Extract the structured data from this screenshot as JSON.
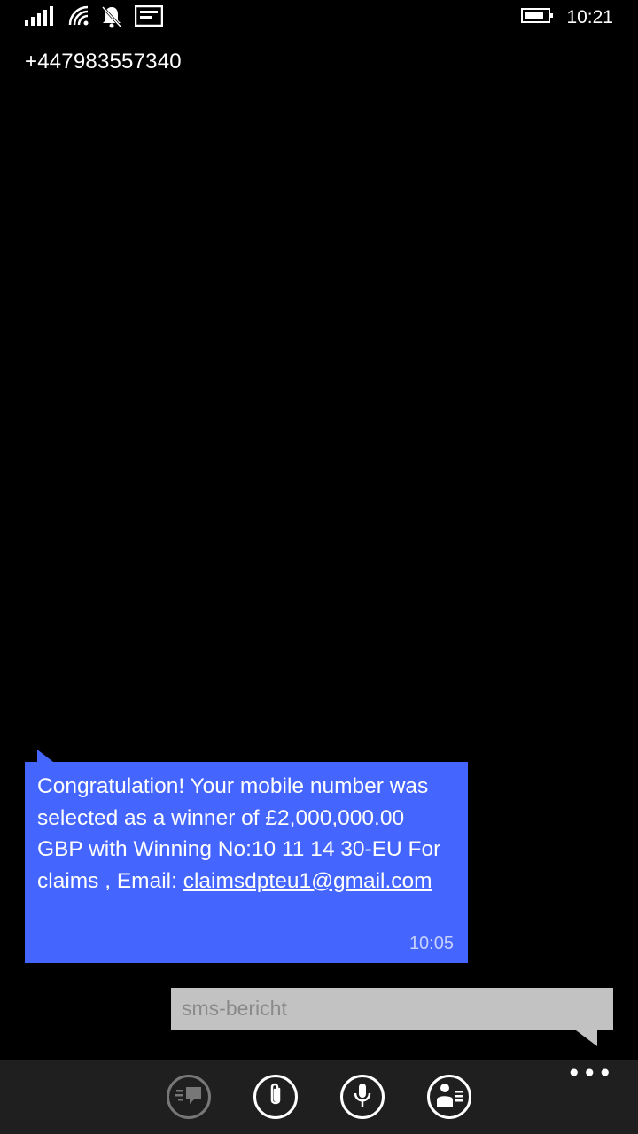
{
  "status_bar": {
    "time": "10:21",
    "icons": [
      "signal-icon",
      "wifi-icon",
      "quiet-hours-icon",
      "notification-icon",
      "battery-icon"
    ]
  },
  "conversation": {
    "contact": "+447983557340"
  },
  "message": {
    "text_before_link": "Congratulation! Your mobile number was selected as a winner of £2,000,000.00 GBP with Winning No:10 11 14 30-EU For claims , Email: ",
    "link": "claimsdpteu1@gmail.com",
    "time": "10:05",
    "color": "#4466ff"
  },
  "composer": {
    "placeholder": "sms-bericht"
  },
  "appbar": {
    "buttons": [
      "switch-icon",
      "attach-icon",
      "microphone-icon",
      "contact-card-icon"
    ],
    "more": "•••"
  }
}
